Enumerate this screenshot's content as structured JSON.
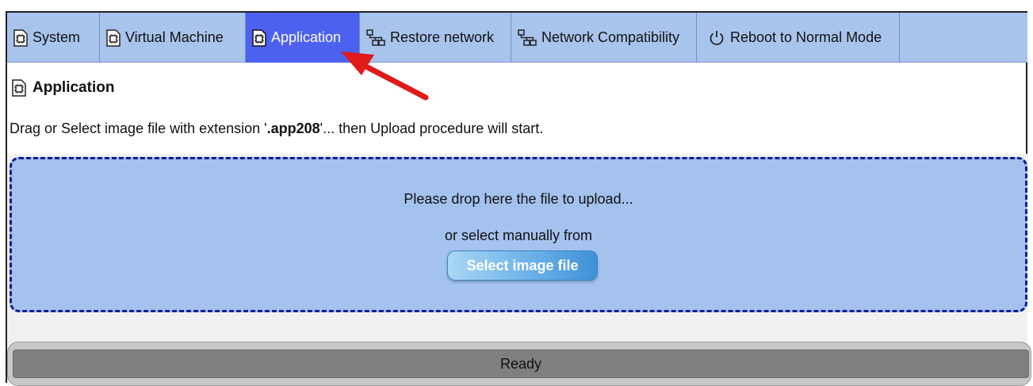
{
  "tabs": [
    {
      "label": "System",
      "icon": "chip-document-icon",
      "active": false
    },
    {
      "label": "Virtual Machine",
      "icon": "chip-document-icon",
      "active": false
    },
    {
      "label": "Application",
      "icon": "chip-document-icon",
      "active": true
    },
    {
      "label": "Restore network",
      "icon": "network-icon",
      "active": false
    },
    {
      "label": "Network Compatibility",
      "icon": "network-icon",
      "active": false
    },
    {
      "label": "Reboot to Normal Mode",
      "icon": "power-icon",
      "active": false
    }
  ],
  "section": {
    "title": "Application",
    "icon": "chip-document-icon",
    "desc_prefix": "Drag or Select image file with extension '",
    "desc_ext": ".app208",
    "desc_suffix": "'... then Upload procedure will start."
  },
  "dropzone": {
    "drop_text": "Please drop here the file to upload...",
    "or_text": "or select manually from",
    "button_label": "Select image file"
  },
  "status": {
    "text": "Ready"
  },
  "colors": {
    "tabbar": "#a8c4ec",
    "active_tab": "#4d61f0",
    "dropzone": "#a4c2ee",
    "dropzone_border": "#0e1f99",
    "status_bar": "#7f7f7f",
    "annotation_arrow": "#e01a1a"
  }
}
